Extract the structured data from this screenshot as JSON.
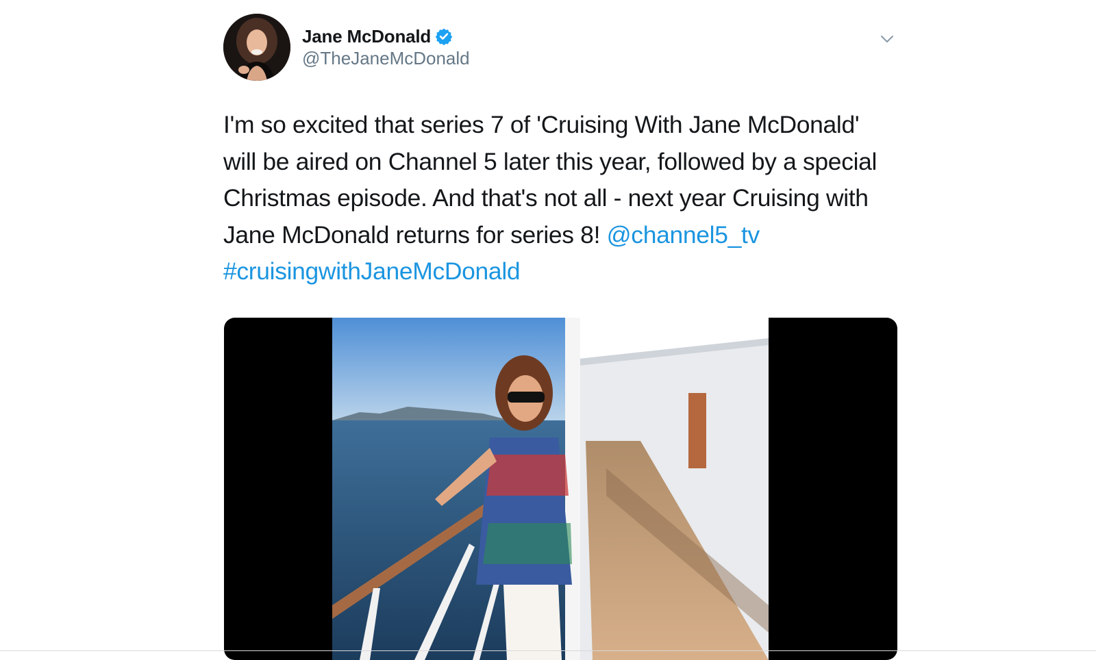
{
  "author": {
    "display_name": "Jane McDonald",
    "handle": "@TheJaneMcDonald",
    "verified": true,
    "avatar_icon": "profile-photo"
  },
  "tweet": {
    "text_plain": "I'm so excited that series 7 of 'Cruising With Jane McDonald' will be aired on Channel 5 later this year, followed by a special Christmas episode. And that's not all - next year Cruising with Jane McDonald returns for series 8!",
    "mention": "@channel5_tv",
    "hashtag": "#cruisingwithJaneMcDonald"
  },
  "media": {
    "type": "photo",
    "icon": "cruise-deck-photo"
  },
  "colors": {
    "link": "#1b95e0",
    "verified": "#1da1f2",
    "secondary_text": "#657786"
  },
  "icons": {
    "menu": "chevron-down-icon",
    "verified": "verified-badge-icon"
  }
}
